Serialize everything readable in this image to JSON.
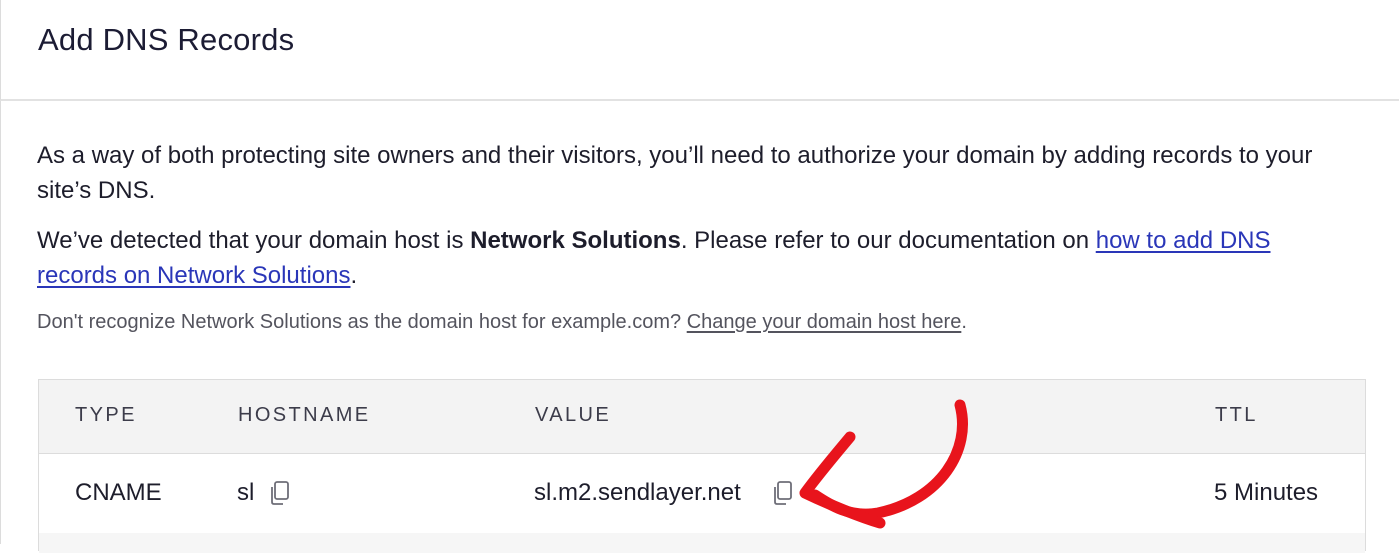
{
  "header": {
    "title": "Add DNS Records"
  },
  "intro": {
    "text": "As a way of both protecting site owners and their visitors, you’ll need to authorize your domain by adding records to your site’s DNS."
  },
  "detected": {
    "prefix": "We’ve detected that your domain host is ",
    "host": "Network Solutions",
    "middle": ". Please refer to our documentation on ",
    "link": "how to add DNS records on Network Solutions",
    "suffix": "."
  },
  "note": {
    "prefix": "Don't recognize Network Solutions as the domain host for example.com? ",
    "link": "Change your domain host here",
    "suffix": "."
  },
  "table": {
    "columns": [
      "TYPE",
      "HOSTNAME",
      "VALUE",
      "TTL"
    ],
    "rows": [
      {
        "type": "CNAME",
        "hostname": "sl",
        "value": "sl.m2.sendlayer.net",
        "ttl": "5 Minutes"
      }
    ]
  },
  "icons": {
    "copy": "copy-icon",
    "annotation": "red-arrow-annotation"
  },
  "colors": {
    "link": "#2a36b8",
    "annotation": "#e8141c",
    "header_bg": "#f3f3f3"
  }
}
